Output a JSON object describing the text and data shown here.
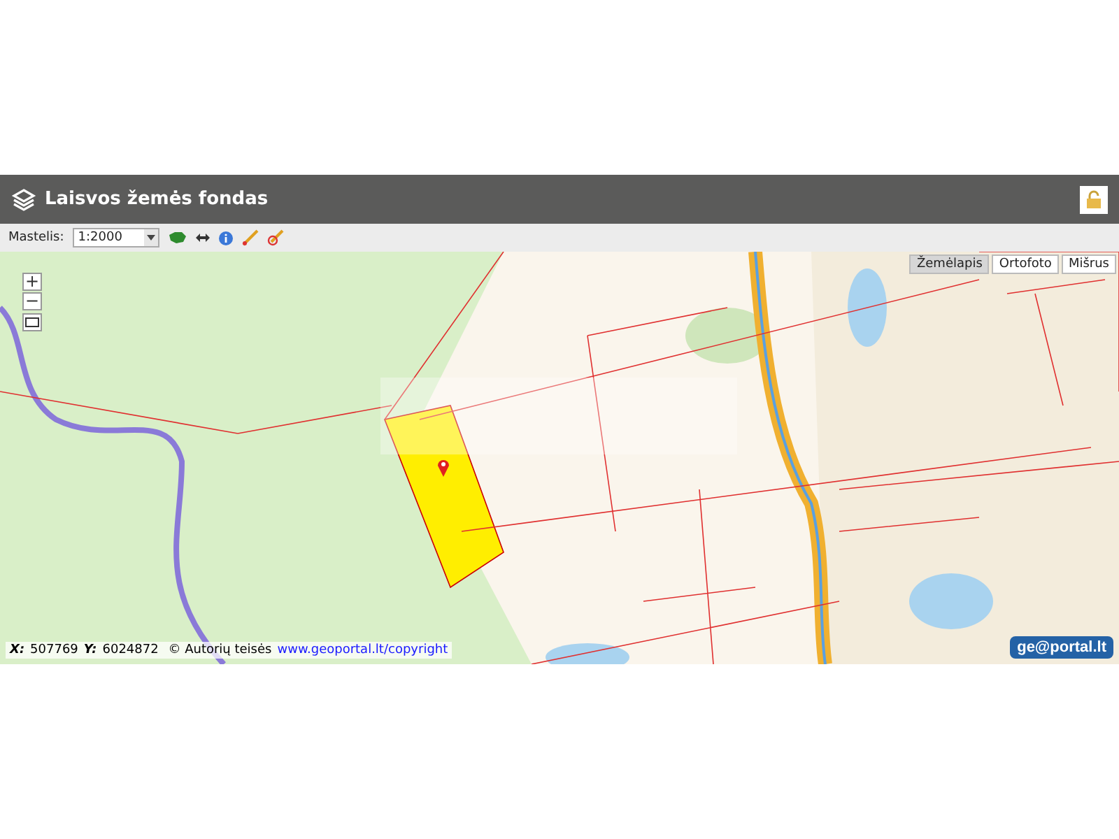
{
  "header": {
    "title": "Laisvos žemės fondas"
  },
  "toolbar": {
    "scale_label": "Mastelis:",
    "scale_value": "1:2000"
  },
  "map": {
    "layer_buttons": [
      {
        "label": "Žemėlapis",
        "selected": true
      },
      {
        "label": "Ortofoto",
        "selected": false
      },
      {
        "label": "Mišrus",
        "selected": false
      }
    ],
    "zoom_in": "+",
    "zoom_out": "−",
    "coordinates": {
      "x_label": "X:",
      "x_value": "507769",
      "y_label": "Y:",
      "y_value": "6024872"
    },
    "copyright": "© Autorių teisės",
    "copyright_link": "www.geoportal.lt/copyright",
    "logo": "ge@portal.lt"
  }
}
